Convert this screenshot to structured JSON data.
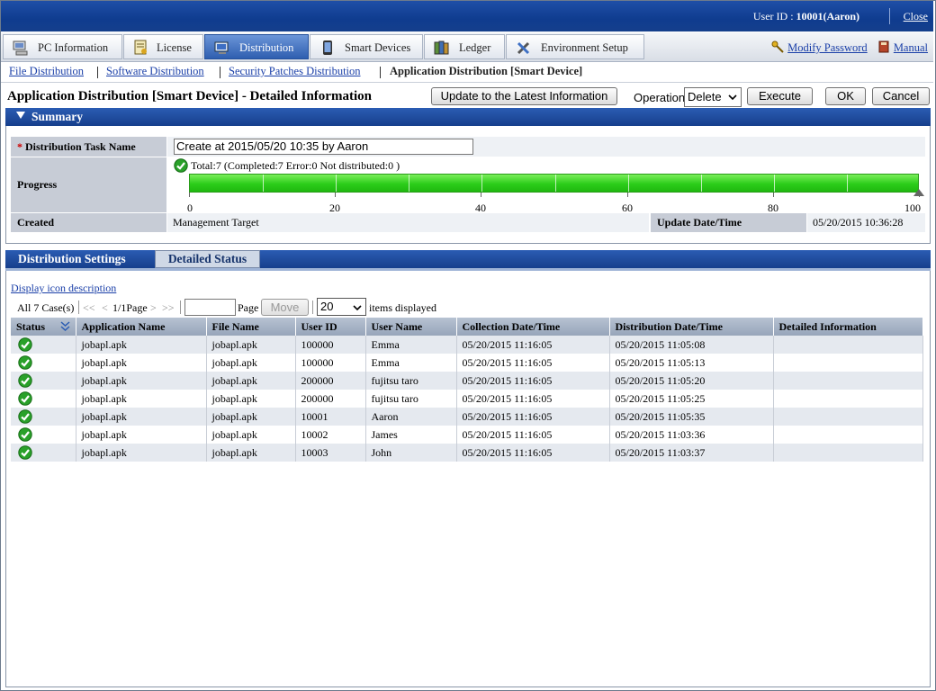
{
  "header": {
    "user_label": "User ID : ",
    "user_value": "10001(Aaron)",
    "close_label": "Close"
  },
  "tabs": [
    {
      "label": "PC Information",
      "icon": "pc-icon"
    },
    {
      "label": "License",
      "icon": "license-icon"
    },
    {
      "label": "Distribution",
      "icon": "distribution-icon",
      "active": true
    },
    {
      "label": "Smart Devices",
      "icon": "smartphone-icon"
    },
    {
      "label": "Ledger",
      "icon": "ledger-icon"
    },
    {
      "label": "Environment Setup",
      "icon": "tools-icon"
    }
  ],
  "right_links": {
    "modify_password": "Modify Password",
    "manual": "Manual"
  },
  "subnav": {
    "file_distribution": "File Distribution",
    "software_distribution": "Software Distribution",
    "security_patches": "Security Patches Distribution",
    "current": "Application Distribution [Smart Device]"
  },
  "page": {
    "title": "Application Distribution [Smart Device] - Detailed Information",
    "update_btn": "Update to the Latest Information",
    "operation_label": "Operation:",
    "operation_value": "Delete",
    "execute_btn": "Execute",
    "ok_btn": "OK",
    "cancel_btn": "Cancel"
  },
  "summary": {
    "title": "Summary",
    "task_name_required": "*",
    "task_name_label": "Distribution Task Name",
    "task_name_value": "Create at 2015/05/20 10:35 by Aaron",
    "progress_label": "Progress",
    "progress_text": "Total:7  (Completed:7  Error:0  Not distributed:0 )",
    "progress_percent": 100,
    "scale_ticks": [
      "0",
      "20",
      "40",
      "60",
      "80",
      "100"
    ],
    "created_label": "Created",
    "created_value": "Management Target",
    "update_label": "Update Date/Time",
    "update_value": "05/20/2015 10:36:28"
  },
  "detail_tabs": {
    "settings": "Distribution Settings",
    "status": "Detailed Status"
  },
  "list": {
    "icon_desc_link": "Display icon description",
    "total_cases": "All 7 Case(s)",
    "nav_first": "<<",
    "nav_prev": "<",
    "page_info": "1/1Page",
    "nav_next": ">",
    "nav_last": ">>",
    "page_label": "Page",
    "move_btn": "Move",
    "per_page": "20",
    "items_label": "items displayed",
    "columns": [
      "Status",
      "Application Name",
      "File Name",
      "User ID",
      "User Name",
      "Collection Date/Time",
      "Distribution Date/Time",
      "Detailed Information"
    ],
    "rows": [
      {
        "app": "jobapl.apk",
        "file": "jobapl.apk",
        "uid": "100000",
        "uname": "Emma",
        "collect": "05/20/2015 11:16:05",
        "dist": "05/20/2015 11:05:08",
        "detail": ""
      },
      {
        "app": "jobapl.apk",
        "file": "jobapl.apk",
        "uid": "100000",
        "uname": "Emma",
        "collect": "05/20/2015 11:16:05",
        "dist": "05/20/2015 11:05:13",
        "detail": ""
      },
      {
        "app": "jobapl.apk",
        "file": "jobapl.apk",
        "uid": "200000",
        "uname": "fujitsu taro",
        "collect": "05/20/2015 11:16:05",
        "dist": "05/20/2015 11:05:20",
        "detail": ""
      },
      {
        "app": "jobapl.apk",
        "file": "jobapl.apk",
        "uid": "200000",
        "uname": "fujitsu taro",
        "collect": "05/20/2015 11:16:05",
        "dist": "05/20/2015 11:05:25",
        "detail": ""
      },
      {
        "app": "jobapl.apk",
        "file": "jobapl.apk",
        "uid": "10001",
        "uname": "Aaron",
        "collect": "05/20/2015 11:16:05",
        "dist": "05/20/2015 11:05:35",
        "detail": ""
      },
      {
        "app": "jobapl.apk",
        "file": "jobapl.apk",
        "uid": "10002",
        "uname": "James",
        "collect": "05/20/2015 11:16:05",
        "dist": "05/20/2015 11:03:36",
        "detail": ""
      },
      {
        "app": "jobapl.apk",
        "file": "jobapl.apk",
        "uid": "10003",
        "uname": "John",
        "collect": "05/20/2015 11:16:05",
        "dist": "05/20/2015 11:03:37",
        "detail": ""
      }
    ]
  },
  "colors": {
    "header_blue": "#153f8c",
    "progress_green": "#2ccd1a",
    "link_blue": "#1a3fa8"
  }
}
